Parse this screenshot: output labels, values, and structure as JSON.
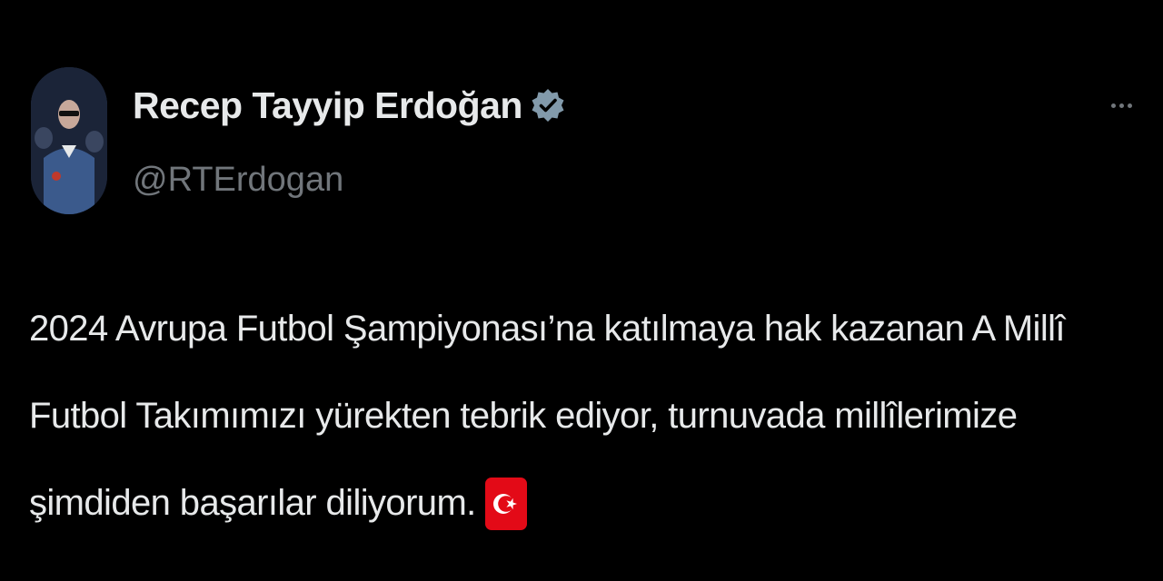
{
  "author": {
    "display_name": "Recep Tayyip Erdoğan",
    "handle": "@RTErdogan",
    "verified": true,
    "avatar_icon": "profile-photo"
  },
  "menu": {
    "icon": "more-options-icon"
  },
  "tweet": {
    "lines": [
      "2024 Avrupa Futbol Şampiyonası’na katılmaya hak kazanan A Millî",
      "Futbol Takımımızı yürekten tebrik ediyor, turnuvada millîlerimize",
      "şimdiden başarılar diliyorum."
    ],
    "emoji": "turkey-flag-emoji"
  },
  "colors": {
    "background": "#000000",
    "text": "#e7e9ea",
    "secondary_text": "#71767b",
    "verified_badge": "#829aab",
    "flag_red": "#e30a17"
  }
}
